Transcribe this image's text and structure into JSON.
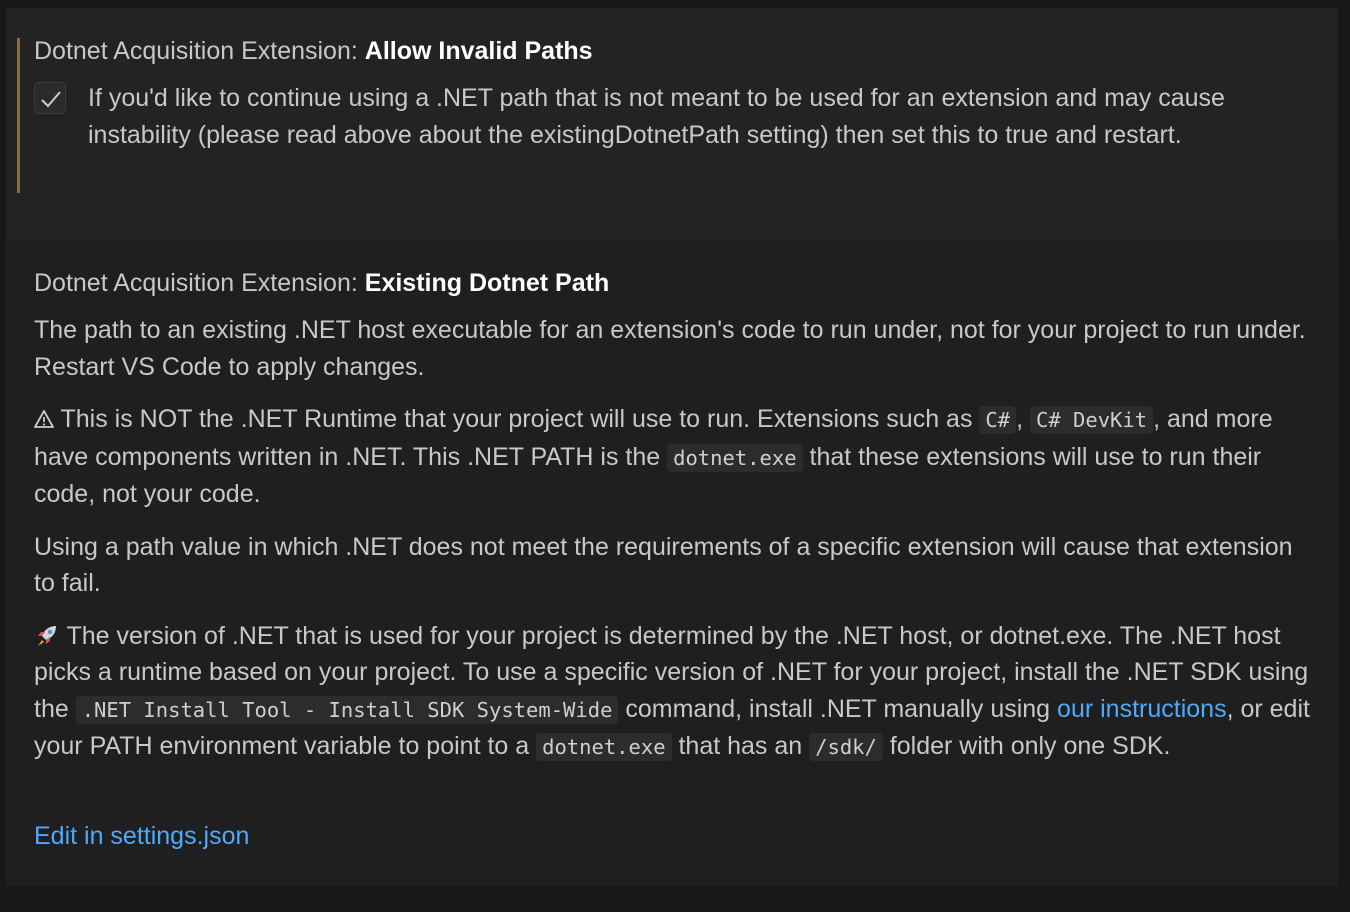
{
  "settings": [
    {
      "category": "Dotnet Acquisition Extension:",
      "name": "Allow Invalid Paths",
      "checked": true,
      "description": "If you'd like to continue using a .NET path that is not meant to be used for an extension and may cause instability (please read above about the existingDotnetPath setting) then set this to true and restart."
    },
    {
      "category": "Dotnet Acquisition Extension:",
      "name": "Existing Dotnet Path",
      "description": {
        "p1": "The path to an existing .NET host executable for an extension's code to run under, not for your project to run under. Restart VS Code to apply changes.",
        "p2": {
          "icon": "warning-icon",
          "t1": " This is NOT the .NET Runtime that your project will use to run. Extensions such as ",
          "c1": "C#",
          "t2": ", ",
          "c2": "C# DevKit",
          "t3": ", and more have components written in .NET. This .NET PATH is the ",
          "c3": "dotnet.exe",
          "t4": " that these extensions will use to run their code, not your code."
        },
        "p3": "Using a path value in which .NET does not meet the requirements of a specific extension will cause that extension to fail.",
        "p4": {
          "icon": "rocket-icon",
          "t1": " The version of .NET that is used for your project is determined by the .NET host, or dotnet.exe. The .NET host picks a runtime based on your project. To use a specific version of .NET for your project, install the .NET SDK using the ",
          "c1": ".NET Install Tool - Install SDK System-Wide",
          "t2": " command, install .NET manually using ",
          "link": "our instructions",
          "t3": ", or edit your PATH environment variable to point to a ",
          "c2": "dotnet.exe",
          "t4": " that has an ",
          "c3": "/sdk/",
          "t5": " folder with only one SDK."
        }
      },
      "edit_link": "Edit in settings.json"
    }
  ],
  "colors": {
    "modified_indicator": "#896b3a",
    "link": "#4daafc"
  }
}
